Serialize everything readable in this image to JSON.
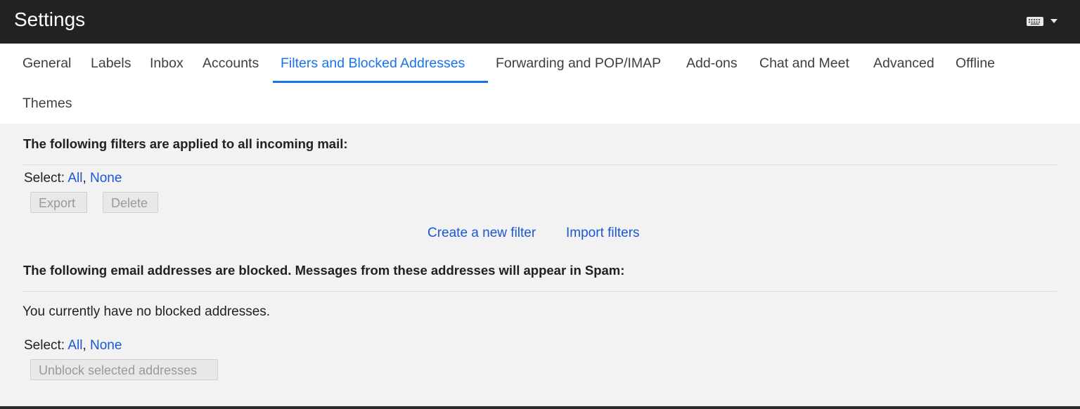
{
  "header": {
    "title": "Settings"
  },
  "tabs": [
    {
      "label": "General",
      "active": false
    },
    {
      "label": "Labels",
      "active": false
    },
    {
      "label": "Inbox",
      "active": false
    },
    {
      "label": "Accounts",
      "active": false
    },
    {
      "label": "Filters and Blocked Addresses",
      "active": true
    },
    {
      "label": "Forwarding and POP/IMAP",
      "active": false
    },
    {
      "label": "Add-ons",
      "active": false
    },
    {
      "label": "Chat and Meet",
      "active": false
    },
    {
      "label": "Advanced",
      "active": false
    },
    {
      "label": "Offline",
      "active": false
    },
    {
      "label": "Themes",
      "active": false
    }
  ],
  "filters": {
    "heading": "The following filters are applied to all incoming mail:",
    "select_label": "Select: ",
    "select_all": "All",
    "select_sep": ", ",
    "select_none": "None",
    "export_label": "Export",
    "delete_label": "Delete",
    "create_link": "Create a new filter",
    "import_link": "Import filters"
  },
  "blocked": {
    "heading": "The following email addresses are blocked. Messages from these addresses will appear in Spam:",
    "empty_message": "You currently have no blocked addresses.",
    "select_label": "Select: ",
    "select_all": "All",
    "select_sep": ", ",
    "select_none": "None",
    "unblock_label": "Unblock selected addresses"
  },
  "colors": {
    "accent": "#1a73e8",
    "link": "#1a57d6",
    "header_bg": "#222222",
    "content_bg": "#f2f2f2"
  },
  "icons": {
    "keyboard": "keyboard-icon",
    "dropdown": "caret-down-icon"
  }
}
